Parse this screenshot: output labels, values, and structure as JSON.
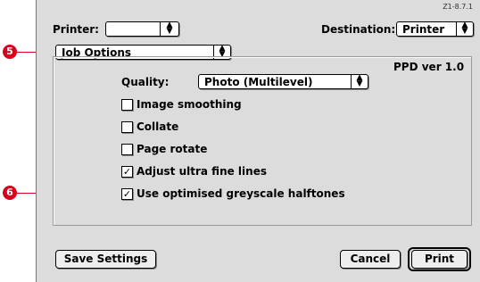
{
  "reference_code": "Z1-8.7.1",
  "printer": {
    "label": "Printer:",
    "value": ""
  },
  "destination": {
    "label": "Destination:",
    "value": "Printer"
  },
  "panel_selector": {
    "value": "Job Options"
  },
  "ppd_version": "PPD ver 1.0",
  "quality": {
    "label": "Quality:",
    "value": "Photo (Multilevel)"
  },
  "options": [
    {
      "label": "Image smoothing",
      "checked": false
    },
    {
      "label": "Collate",
      "checked": false
    },
    {
      "label": "Page rotate",
      "checked": false
    },
    {
      "label": "Adjust ultra fine lines",
      "checked": true
    },
    {
      "label": "Use optimised greyscale halftones",
      "checked": true
    }
  ],
  "buttons": {
    "save": "Save Settings",
    "cancel": "Cancel",
    "print": "Print"
  },
  "callouts": [
    {
      "number": "5",
      "target": "Job Options popup"
    },
    {
      "number": "6",
      "target": "Use optimised greyscale halftones checkbox"
    }
  ],
  "colors": {
    "callout": "#d9001b",
    "dialog_bg": "#dcdcdc"
  }
}
